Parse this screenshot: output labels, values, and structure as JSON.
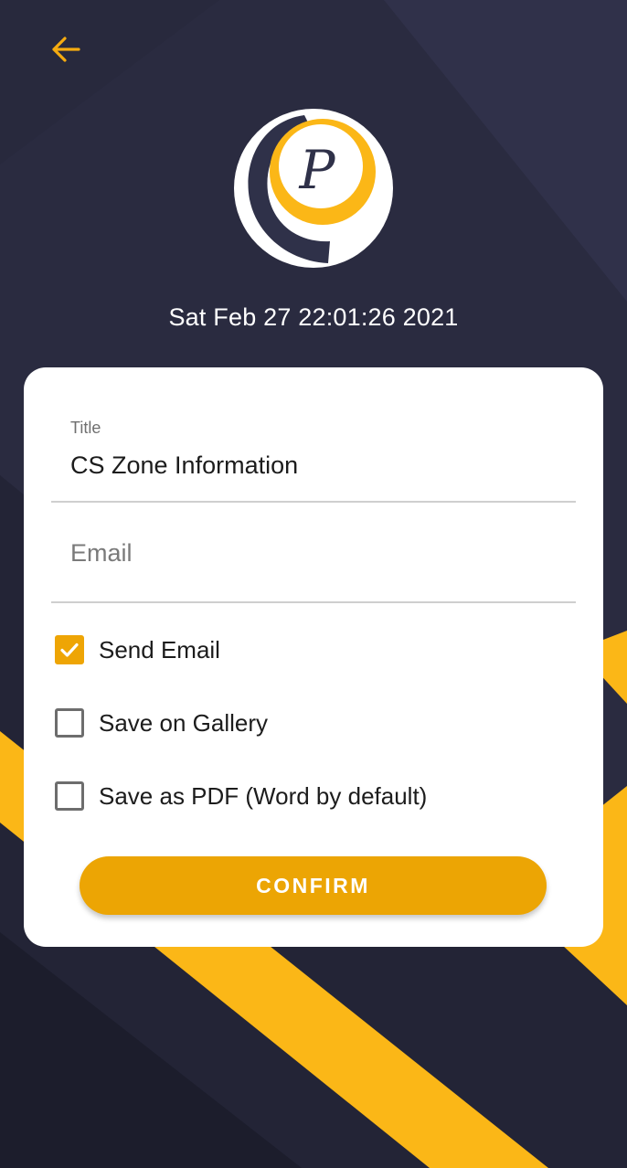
{
  "colors": {
    "background": "#2a2b40",
    "accent": "#eea505",
    "stripe": "#fbb717",
    "card": "#ffffff"
  },
  "header": {
    "back_icon": "arrow-left-icon",
    "logo_letter": "P",
    "timestamp": "Sat Feb 27 22:01:26 2021"
  },
  "form": {
    "title_field": {
      "label": "Title",
      "value": "CS Zone Information"
    },
    "email_field": {
      "placeholder": "Email",
      "value": ""
    },
    "options": [
      {
        "label": "Send Email",
        "checked": true
      },
      {
        "label": "Save on Gallery",
        "checked": false
      },
      {
        "label": "Save as PDF (Word by default)",
        "checked": false
      }
    ],
    "confirm_label": "CONFIRM"
  }
}
